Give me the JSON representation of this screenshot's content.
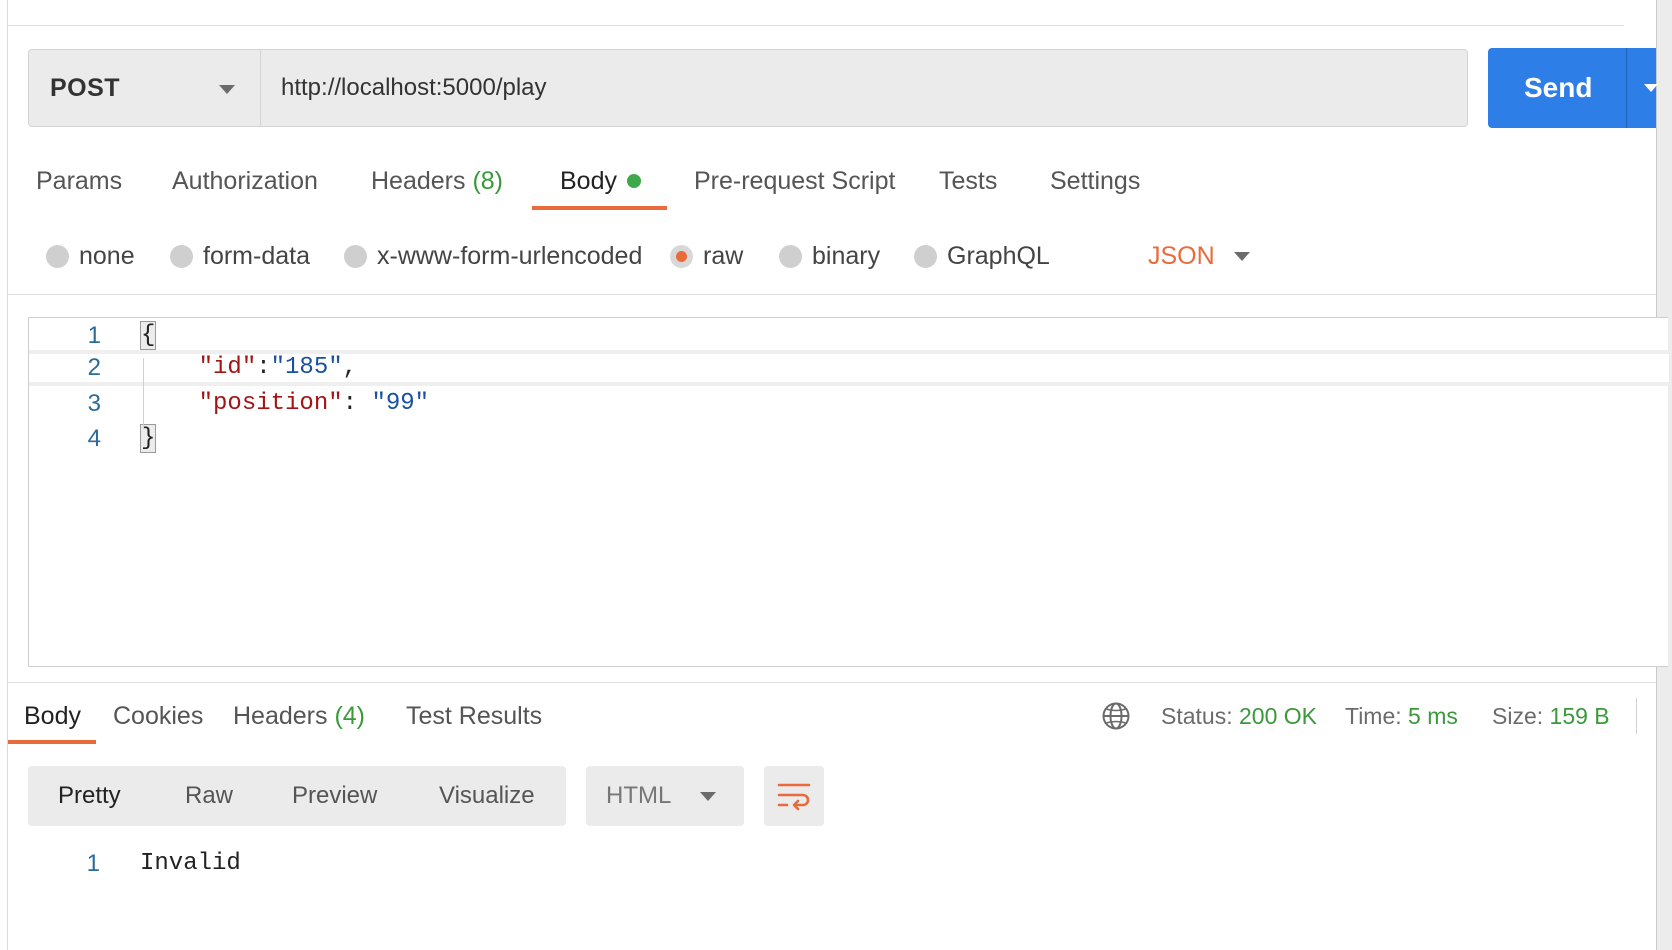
{
  "request": {
    "method": "POST",
    "url": "http://localhost:5000/play",
    "send_label": "Send"
  },
  "request_tabs": [
    {
      "label": "Params"
    },
    {
      "label": "Authorization"
    },
    {
      "label": "Headers",
      "count": "(8)"
    },
    {
      "label": "Body",
      "active": true,
      "indicator": "green-dot"
    },
    {
      "label": "Pre-request Script"
    },
    {
      "label": "Tests"
    },
    {
      "label": "Settings"
    }
  ],
  "body_types": [
    {
      "label": "none"
    },
    {
      "label": "form-data"
    },
    {
      "label": "x-www-form-urlencoded"
    },
    {
      "label": "raw",
      "checked": true
    },
    {
      "label": "binary"
    },
    {
      "label": "GraphQL"
    }
  ],
  "body_format": "JSON",
  "editor": {
    "line_numbers": [
      "1",
      "2",
      "3",
      "4"
    ],
    "line1": "{",
    "line2_key": "\"id\"",
    "line2_sep": ":",
    "line2_val": "\"185\"",
    "line2_end": ",",
    "line3_key": "\"position\"",
    "line3_sep": ": ",
    "line3_val": "\"99\"",
    "line4": "}"
  },
  "response_tabs": [
    {
      "label": "Body",
      "active": true
    },
    {
      "label": "Cookies"
    },
    {
      "label": "Headers",
      "count": "(4)"
    },
    {
      "label": "Test Results"
    }
  ],
  "response_meta": {
    "status_label": "Status:",
    "status_value": "200 OK",
    "time_label": "Time:",
    "time_value": "5 ms",
    "size_label": "Size:",
    "size_value": "159 B"
  },
  "response_views": [
    "Pretty",
    "Raw",
    "Preview",
    "Visualize"
  ],
  "response_format": "HTML",
  "response_body": {
    "line_number": "1",
    "text": "Invalid"
  },
  "colors": {
    "accent": "#e96b3b",
    "send": "#2e7ee8",
    "success": "#3a9a3a"
  },
  "icons": [
    "dropdown-caret-icon",
    "globe-icon",
    "wrap-lines-icon"
  ]
}
